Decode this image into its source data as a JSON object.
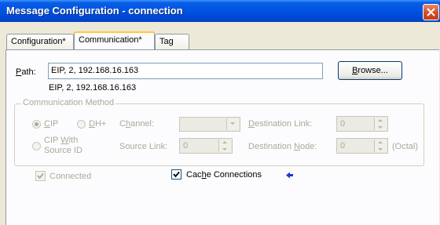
{
  "window": {
    "title": "Message Configuration - connection"
  },
  "tabs": [
    {
      "label": "Configuration*"
    },
    {
      "label": "Communication*"
    },
    {
      "label": "Tag"
    }
  ],
  "path": {
    "label": "Path:",
    "value": "EIP, 2, 192.168.16.163",
    "resolved": "EIP, 2, 192.168.16.163",
    "browse_label": "Browse..."
  },
  "comm_method": {
    "legend": "Communication Method",
    "cip_label": "CIP",
    "dhplus_label": "DH+",
    "channel_label": "Channel:",
    "channel_value": "",
    "dest_link_label": "Destination Link:",
    "dest_link_value": "0",
    "cip_with_source_line1": "CIP With",
    "cip_with_source_line2": "Source ID",
    "source_link_label": "Source Link:",
    "source_link_value": "0",
    "dest_node_label": "Destination Node:",
    "dest_node_value": "0",
    "octal_label": "(Octal)"
  },
  "options": {
    "connected_label": "Connected",
    "connected_checked": true,
    "cache_label": "Cache Connections",
    "cache_checked": true
  },
  "colors": {
    "title_bar": "#0054e3",
    "close_button": "#d24f26",
    "disabled_text": "#aca899",
    "arrow_indicator": "#1a3cc8"
  }
}
